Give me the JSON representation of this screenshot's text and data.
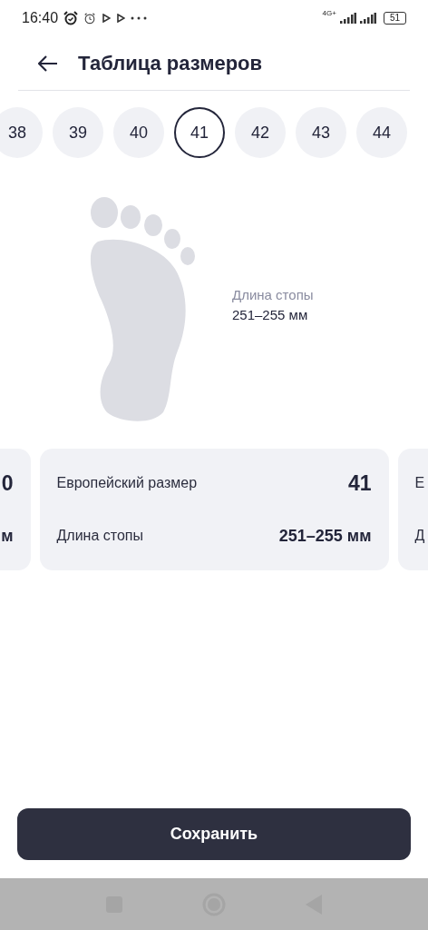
{
  "status_bar": {
    "time": "16:40",
    "network": "4G+",
    "battery": "51"
  },
  "header": {
    "title": "Таблица размеров"
  },
  "sizes": [
    {
      "label": "38",
      "selected": false
    },
    {
      "label": "39",
      "selected": false
    },
    {
      "label": "40",
      "selected": false
    },
    {
      "label": "41",
      "selected": true
    },
    {
      "label": "42",
      "selected": false
    },
    {
      "label": "43",
      "selected": false
    },
    {
      "label": "44",
      "selected": false
    }
  ],
  "foot": {
    "label": "Длина стопы",
    "value": "251–255 мм"
  },
  "cards": [
    {
      "rows": [
        {
          "value": "0"
        },
        {
          "value": "м"
        }
      ]
    },
    {
      "rows": [
        {
          "label": "Европейский размер",
          "value": "41",
          "kind": "size"
        },
        {
          "label": "Длина стопы",
          "value": "251–255 мм",
          "kind": "length"
        }
      ]
    },
    {
      "rows": [
        {
          "label": "Е"
        },
        {
          "label": "Д"
        }
      ]
    }
  ],
  "save_button": "Сохранить"
}
